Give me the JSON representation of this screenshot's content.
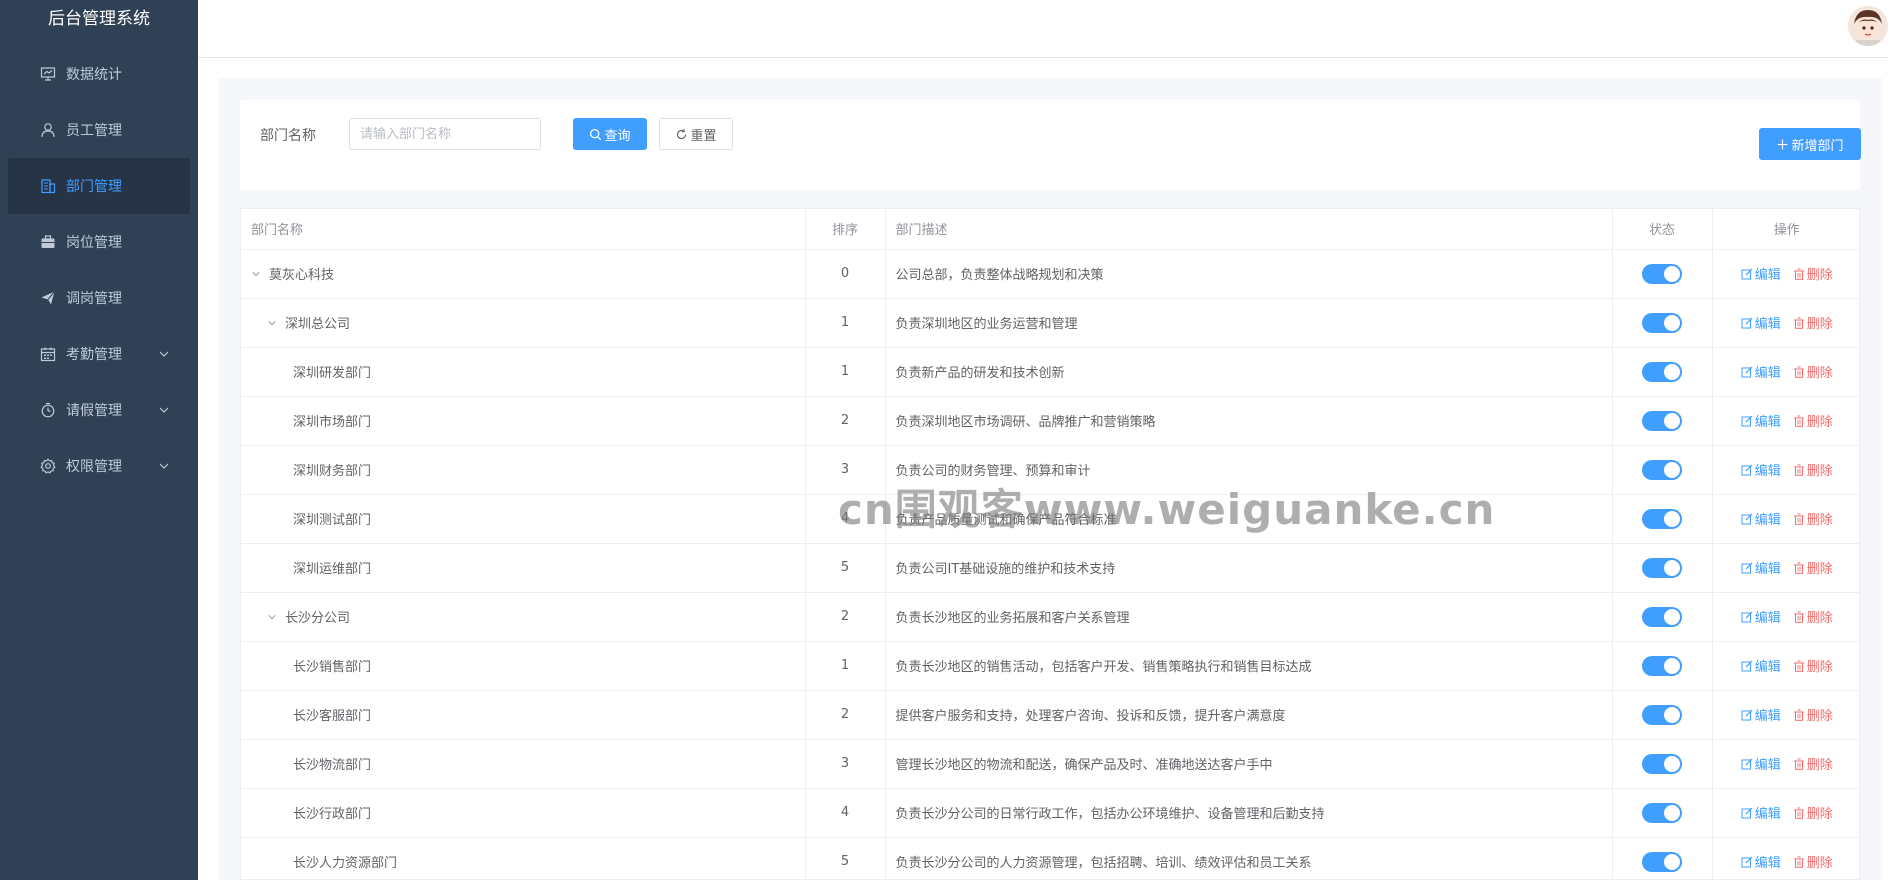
{
  "app": {
    "title": "后台管理系统"
  },
  "sidebar": {
    "items": [
      {
        "label": "数据统计",
        "icon": "chart-icon",
        "active": false,
        "expandable": false
      },
      {
        "label": "员工管理",
        "icon": "user-icon",
        "active": false,
        "expandable": false
      },
      {
        "label": "部门管理",
        "icon": "building-icon",
        "active": true,
        "expandable": false
      },
      {
        "label": "岗位管理",
        "icon": "briefcase-icon",
        "active": false,
        "expandable": false
      },
      {
        "label": "调岗管理",
        "icon": "send-icon",
        "active": false,
        "expandable": false
      },
      {
        "label": "考勤管理",
        "icon": "calendar-icon",
        "active": false,
        "expandable": true
      },
      {
        "label": "请假管理",
        "icon": "clock-icon",
        "active": false,
        "expandable": true
      },
      {
        "label": "权限管理",
        "icon": "gear-icon",
        "active": false,
        "expandable": true
      }
    ]
  },
  "search": {
    "label": "部门名称",
    "placeholder": "请输入部门名称",
    "value": "",
    "query_label": "查询",
    "reset_label": "重置",
    "add_label": "新增部门"
  },
  "table": {
    "headers": {
      "name": "部门名称",
      "sort": "排序",
      "desc": "部门描述",
      "status": "状态",
      "ops": "操作"
    },
    "edit_label": "编辑",
    "delete_label": "删除",
    "rows": [
      {
        "name": "莫灰心科技",
        "sort": "0",
        "desc": "公司总部，负责整体战略规划和决策",
        "level": 0,
        "expanded": true,
        "status": true
      },
      {
        "name": "深圳总公司",
        "sort": "1",
        "desc": "负责深圳地区的业务运营和管理",
        "level": 1,
        "expanded": true,
        "status": true
      },
      {
        "name": "深圳研发部门",
        "sort": "1",
        "desc": "负责新产品的研发和技术创新",
        "level": 2,
        "status": true
      },
      {
        "name": "深圳市场部门",
        "sort": "2",
        "desc": "负责深圳地区市场调研、品牌推广和营销策略",
        "level": 2,
        "status": true
      },
      {
        "name": "深圳财务部门",
        "sort": "3",
        "desc": "负责公司的财务管理、预算和审计",
        "level": 2,
        "status": true
      },
      {
        "name": "深圳测试部门",
        "sort": "4",
        "desc": "负责产品质量测试和确保产品符合标准",
        "level": 2,
        "status": true
      },
      {
        "name": "深圳运维部门",
        "sort": "5",
        "desc": "负责公司IT基础设施的维护和技术支持",
        "level": 2,
        "status": true
      },
      {
        "name": "长沙分公司",
        "sort": "2",
        "desc": "负责长沙地区的业务拓展和客户关系管理",
        "level": 1,
        "expanded": true,
        "status": true
      },
      {
        "name": "长沙销售部门",
        "sort": "1",
        "desc": "负责长沙地区的销售活动，包括客户开发、销售策略执行和销售目标达成",
        "level": 2,
        "status": true
      },
      {
        "name": "长沙客服部门",
        "sort": "2",
        "desc": "提供客户服务和支持，处理客户咨询、投诉和反馈，提升客户满意度",
        "level": 2,
        "status": true
      },
      {
        "name": "长沙物流部门",
        "sort": "3",
        "desc": "管理长沙地区的物流和配送，确保产品及时、准确地送达客户手中",
        "level": 2,
        "status": true
      },
      {
        "name": "长沙行政部门",
        "sort": "4",
        "desc": "负责长沙分公司的日常行政工作，包括办公环境维护、设备管理和后勤支持",
        "level": 2,
        "status": true
      },
      {
        "name": "长沙人力资源部门",
        "sort": "5",
        "desc": "负责长沙分公司的人力资源管理，包括招聘、培训、绩效评估和员工关系",
        "level": 2,
        "status": true
      }
    ]
  },
  "watermark": "cn围观客www.weiguanke.cn",
  "colors": {
    "sidebar_bg": "#304156",
    "accent": "#409eff",
    "danger": "#f56c6c"
  }
}
